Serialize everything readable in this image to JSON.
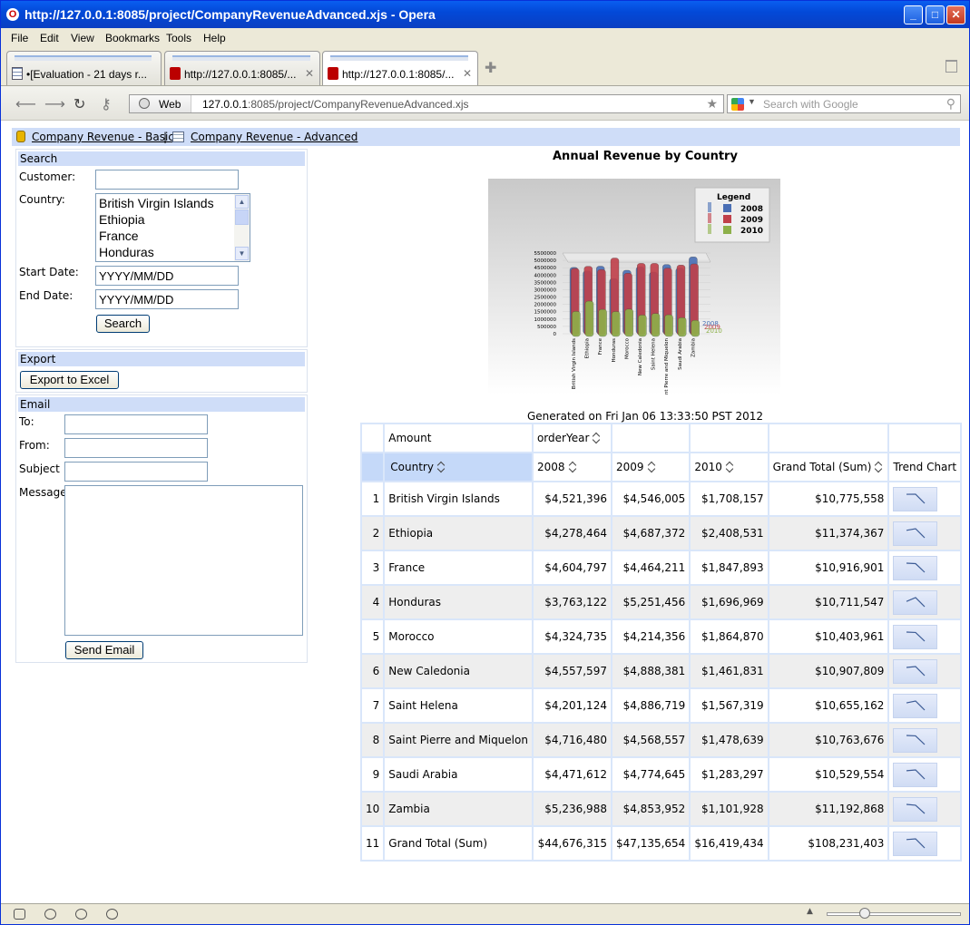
{
  "window": {
    "title": "http://127.0.0.1:8085/project/CompanyRevenueAdvanced.xjs - Opera"
  },
  "menu": [
    "File",
    "Edit",
    "View",
    "Bookmarks",
    "Tools",
    "Help"
  ],
  "tabs": [
    {
      "label": "•[Evaluation - 21 days r..."
    },
    {
      "label": "http://127.0.0.1:8085/..."
    },
    {
      "label": "http://127.0.0.1:8085/..."
    }
  ],
  "address": {
    "scheme_label": "Web",
    "host": "127.0.0.1",
    "rest": ":8085/project/CompanyRevenueAdvanced.xjs"
  },
  "search": {
    "placeholder": "Search with Google"
  },
  "links": {
    "basic": "Company Revenue - Basic",
    "sep": "|",
    "advanced": "Company Revenue - Advanced"
  },
  "search_panel": {
    "title": "Search",
    "customer_label": "Customer:",
    "country_label": "Country:",
    "countries": [
      "British Virgin Islands",
      "Ethiopia",
      "France",
      "Honduras"
    ],
    "start_label": "Start Date:",
    "start_placeholder": "YYYY/MM/DD",
    "end_label": "End Date:",
    "end_placeholder": "YYYY/MM/DD",
    "search_button": "Search"
  },
  "export_panel": {
    "title": "Export",
    "button": "Export to Excel"
  },
  "email_panel": {
    "title": "Email",
    "to_label": "To:",
    "from_label": "From:",
    "subject_label": "Subject",
    "message_label": "Message",
    "send_button": "Send Email"
  },
  "report": {
    "title": "Annual Revenue by Country",
    "generated": "Generated on Fri Jan 06 13:33:50 PST 2012",
    "header1": {
      "measure": "Amount",
      "col_field": "orderYear"
    },
    "header2": {
      "country": "Country",
      "y2008": "2008",
      "y2009": "2009",
      "y2010": "2010",
      "total": "Grand Total (Sum)",
      "trend": "Trend Chart"
    },
    "rows": [
      {
        "n": "1",
        "country": "British Virgin Islands",
        "y2008": "$4,521,396",
        "y2009": "$4,546,005",
        "y2010": "$1,708,157",
        "total": "$10,775,558"
      },
      {
        "n": "2",
        "country": "Ethiopia",
        "y2008": "$4,278,464",
        "y2009": "$4,687,372",
        "y2010": "$2,408,531",
        "total": "$11,374,367"
      },
      {
        "n": "3",
        "country": "France",
        "y2008": "$4,604,797",
        "y2009": "$4,464,211",
        "y2010": "$1,847,893",
        "total": "$10,916,901"
      },
      {
        "n": "4",
        "country": "Honduras",
        "y2008": "$3,763,122",
        "y2009": "$5,251,456",
        "y2010": "$1,696,969",
        "total": "$10,711,547"
      },
      {
        "n": "5",
        "country": "Morocco",
        "y2008": "$4,324,735",
        "y2009": "$4,214,356",
        "y2010": "$1,864,870",
        "total": "$10,403,961"
      },
      {
        "n": "6",
        "country": "New Caledonia",
        "y2008": "$4,557,597",
        "y2009": "$4,888,381",
        "y2010": "$1,461,831",
        "total": "$10,907,809"
      },
      {
        "n": "7",
        "country": "Saint Helena",
        "y2008": "$4,201,124",
        "y2009": "$4,886,719",
        "y2010": "$1,567,319",
        "total": "$10,655,162"
      },
      {
        "n": "8",
        "country": "Saint Pierre and Miquelon",
        "y2008": "$4,716,480",
        "y2009": "$4,568,557",
        "y2010": "$1,478,639",
        "total": "$10,763,676"
      },
      {
        "n": "9",
        "country": "Saudi Arabia",
        "y2008": "$4,471,612",
        "y2009": "$4,774,645",
        "y2010": "$1,283,297",
        "total": "$10,529,554"
      },
      {
        "n": "10",
        "country": "Zambia",
        "y2008": "$5,236,988",
        "y2009": "$4,853,952",
        "y2010": "$1,101,928",
        "total": "$11,192,868"
      },
      {
        "n": "11",
        "country": "Grand Total (Sum)",
        "y2008": "$44,676,315",
        "y2009": "$47,135,654",
        "y2010": "$16,419,434",
        "total": "$108,231,403"
      }
    ]
  },
  "mini_chart": {
    "legend_title": "Legend",
    "series": [
      {
        "name": "2008",
        "color": "#4a6fb5"
      },
      {
        "name": "2009",
        "color": "#c0404a"
      },
      {
        "name": "2010",
        "color": "#8db04a"
      }
    ],
    "y_ticks": [
      "5500000",
      "5000000",
      "4500000",
      "4000000",
      "3500000",
      "3000000",
      "2500000",
      "2000000",
      "1500000",
      "1000000",
      "500000",
      "0"
    ],
    "categories": [
      "British Virgin Islands",
      "Ethiopia",
      "France",
      "Honduras",
      "Morocco",
      "New Caledonia",
      "Saint Helena",
      "Saint Pierre and Miquelon",
      "Saudi Arabia",
      "Zambia"
    ],
    "values_2008": [
      4521396,
      4278464,
      4604797,
      3763122,
      4324735,
      4557597,
      4201124,
      4716480,
      4471612,
      5236988
    ],
    "values_2009": [
      4546005,
      4687372,
      4464211,
      5251456,
      4214356,
      4888381,
      4886719,
      4568557,
      4774645,
      4853952
    ],
    "values_2010": [
      1708157,
      2408531,
      1847893,
      1696969,
      1864870,
      1461831,
      1567319,
      1478639,
      1283297,
      1101928
    ]
  }
}
